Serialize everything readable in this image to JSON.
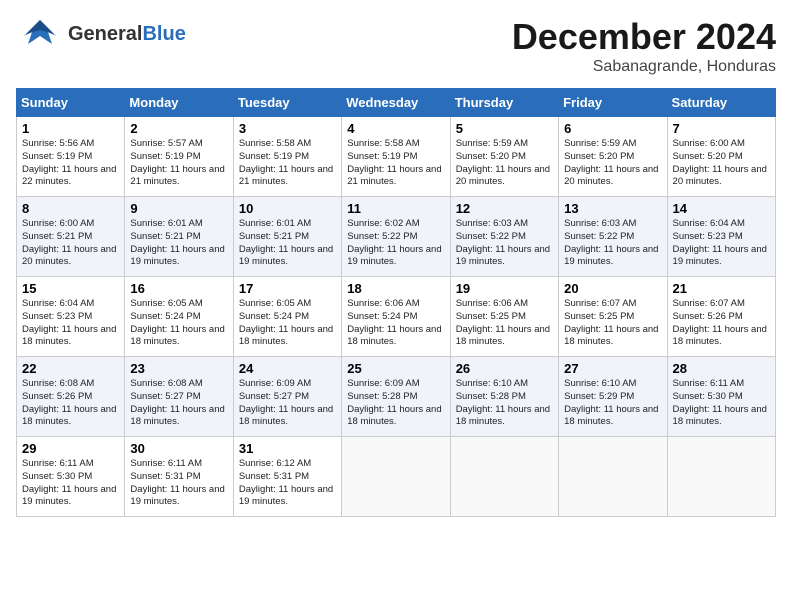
{
  "header": {
    "logo_general": "General",
    "logo_blue": "Blue",
    "month": "December 2024",
    "location": "Sabanagrande, Honduras"
  },
  "weekdays": [
    "Sunday",
    "Monday",
    "Tuesday",
    "Wednesday",
    "Thursday",
    "Friday",
    "Saturday"
  ],
  "weeks": [
    [
      {
        "day": "1",
        "sunrise": "5:56 AM",
        "sunset": "5:19 PM",
        "daylight": "11 hours and 22 minutes."
      },
      {
        "day": "2",
        "sunrise": "5:57 AM",
        "sunset": "5:19 PM",
        "daylight": "11 hours and 21 minutes."
      },
      {
        "day": "3",
        "sunrise": "5:58 AM",
        "sunset": "5:19 PM",
        "daylight": "11 hours and 21 minutes."
      },
      {
        "day": "4",
        "sunrise": "5:58 AM",
        "sunset": "5:19 PM",
        "daylight": "11 hours and 21 minutes."
      },
      {
        "day": "5",
        "sunrise": "5:59 AM",
        "sunset": "5:20 PM",
        "daylight": "11 hours and 20 minutes."
      },
      {
        "day": "6",
        "sunrise": "5:59 AM",
        "sunset": "5:20 PM",
        "daylight": "11 hours and 20 minutes."
      },
      {
        "day": "7",
        "sunrise": "6:00 AM",
        "sunset": "5:20 PM",
        "daylight": "11 hours and 20 minutes."
      }
    ],
    [
      {
        "day": "8",
        "sunrise": "6:00 AM",
        "sunset": "5:21 PM",
        "daylight": "11 hours and 20 minutes."
      },
      {
        "day": "9",
        "sunrise": "6:01 AM",
        "sunset": "5:21 PM",
        "daylight": "11 hours and 19 minutes."
      },
      {
        "day": "10",
        "sunrise": "6:01 AM",
        "sunset": "5:21 PM",
        "daylight": "11 hours and 19 minutes."
      },
      {
        "day": "11",
        "sunrise": "6:02 AM",
        "sunset": "5:22 PM",
        "daylight": "11 hours and 19 minutes."
      },
      {
        "day": "12",
        "sunrise": "6:03 AM",
        "sunset": "5:22 PM",
        "daylight": "11 hours and 19 minutes."
      },
      {
        "day": "13",
        "sunrise": "6:03 AM",
        "sunset": "5:22 PM",
        "daylight": "11 hours and 19 minutes."
      },
      {
        "day": "14",
        "sunrise": "6:04 AM",
        "sunset": "5:23 PM",
        "daylight": "11 hours and 19 minutes."
      }
    ],
    [
      {
        "day": "15",
        "sunrise": "6:04 AM",
        "sunset": "5:23 PM",
        "daylight": "11 hours and 18 minutes."
      },
      {
        "day": "16",
        "sunrise": "6:05 AM",
        "sunset": "5:24 PM",
        "daylight": "11 hours and 18 minutes."
      },
      {
        "day": "17",
        "sunrise": "6:05 AM",
        "sunset": "5:24 PM",
        "daylight": "11 hours and 18 minutes."
      },
      {
        "day": "18",
        "sunrise": "6:06 AM",
        "sunset": "5:24 PM",
        "daylight": "11 hours and 18 minutes."
      },
      {
        "day": "19",
        "sunrise": "6:06 AM",
        "sunset": "5:25 PM",
        "daylight": "11 hours and 18 minutes."
      },
      {
        "day": "20",
        "sunrise": "6:07 AM",
        "sunset": "5:25 PM",
        "daylight": "11 hours and 18 minutes."
      },
      {
        "day": "21",
        "sunrise": "6:07 AM",
        "sunset": "5:26 PM",
        "daylight": "11 hours and 18 minutes."
      }
    ],
    [
      {
        "day": "22",
        "sunrise": "6:08 AM",
        "sunset": "5:26 PM",
        "daylight": "11 hours and 18 minutes."
      },
      {
        "day": "23",
        "sunrise": "6:08 AM",
        "sunset": "5:27 PM",
        "daylight": "11 hours and 18 minutes."
      },
      {
        "day": "24",
        "sunrise": "6:09 AM",
        "sunset": "5:27 PM",
        "daylight": "11 hours and 18 minutes."
      },
      {
        "day": "25",
        "sunrise": "6:09 AM",
        "sunset": "5:28 PM",
        "daylight": "11 hours and 18 minutes."
      },
      {
        "day": "26",
        "sunrise": "6:10 AM",
        "sunset": "5:28 PM",
        "daylight": "11 hours and 18 minutes."
      },
      {
        "day": "27",
        "sunrise": "6:10 AM",
        "sunset": "5:29 PM",
        "daylight": "11 hours and 18 minutes."
      },
      {
        "day": "28",
        "sunrise": "6:11 AM",
        "sunset": "5:30 PM",
        "daylight": "11 hours and 18 minutes."
      }
    ],
    [
      {
        "day": "29",
        "sunrise": "6:11 AM",
        "sunset": "5:30 PM",
        "daylight": "11 hours and 19 minutes."
      },
      {
        "day": "30",
        "sunrise": "6:11 AM",
        "sunset": "5:31 PM",
        "daylight": "11 hours and 19 minutes."
      },
      {
        "day": "31",
        "sunrise": "6:12 AM",
        "sunset": "5:31 PM",
        "daylight": "11 hours and 19 minutes."
      },
      null,
      null,
      null,
      null
    ]
  ]
}
